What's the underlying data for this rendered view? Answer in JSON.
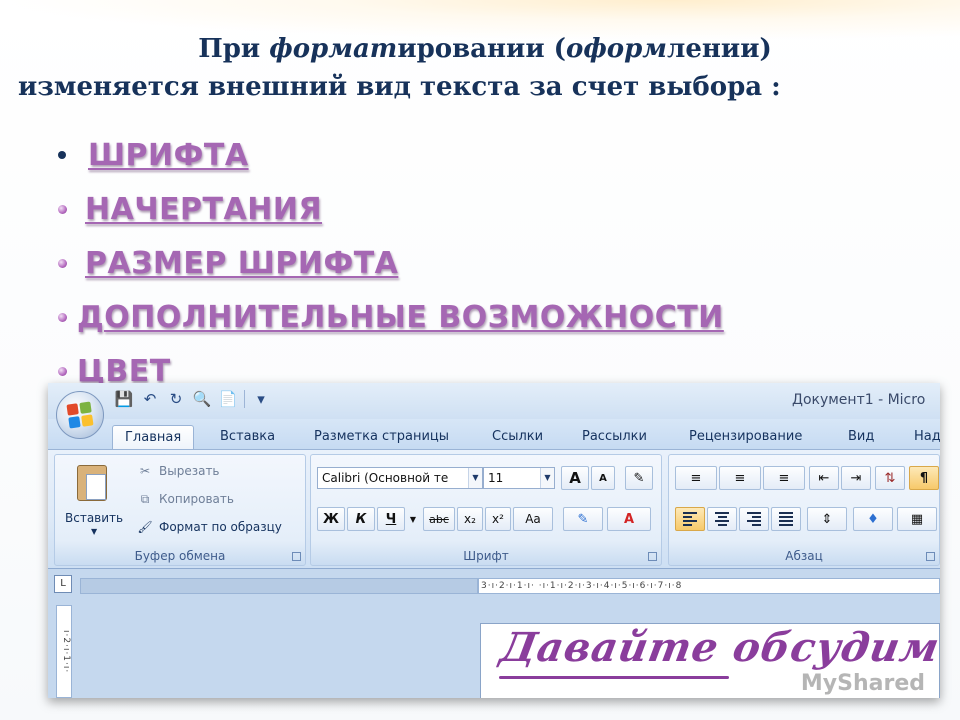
{
  "heading": {
    "line1_a": "При ",
    "line1_b": "формат",
    "line1_c": "ировании (",
    "line1_d": "оформ",
    "line1_e": "лении)",
    "line2": "изменяется внешний вид текста за счет выбора :"
  },
  "bullets": [
    {
      "label": "ШРИФТА"
    },
    {
      "label": "НАЧЕРТАНИЯ"
    },
    {
      "label": "РАЗМЕР ШРИФТА"
    },
    {
      "label": "ДОПОЛНИТЕЛЬНЫЕ ВОЗМОЖНОСТИ"
    },
    {
      "label": "ЦВЕТ"
    }
  ],
  "word": {
    "window_title": "Документ1 - Micro",
    "tabs": [
      "Главная",
      "Вставка",
      "Разметка страницы",
      "Ссылки",
      "Рассылки",
      "Рецензирование",
      "Вид",
      "Над"
    ],
    "clipboard": {
      "paste": "Вставить",
      "cut": "Вырезать",
      "copy": "Копировать",
      "format_painter": "Формат по образцу",
      "label": "Буфер обмена"
    },
    "font": {
      "font_name": "Calibri (Основной те",
      "font_size": "11",
      "bold": "Ж",
      "italic": "К",
      "underline": "Ч",
      "strike": "abc",
      "subscript": "x₂",
      "superscript": "x²",
      "change_case": "Aa",
      "grow": "A",
      "shrink": "A",
      "label": "Шрифт"
    },
    "paragraph": {
      "label": "Абзац"
    },
    "hruler_text": "3·ı·2·ı·1·ı· ·ı·1·ı·2·ı·3·ı·4·ı·5·ı·6·ı·7·ı·8",
    "vruler_text": "ı·2·ı·1·ı·",
    "document_text": "Давайте обсудим",
    "watermark": "MyShared"
  },
  "colors": {
    "heading": "#17325a",
    "bullet_link": "#a567b3",
    "script": "#8a3d9c",
    "ribbon_bg": "#dde9f7"
  }
}
